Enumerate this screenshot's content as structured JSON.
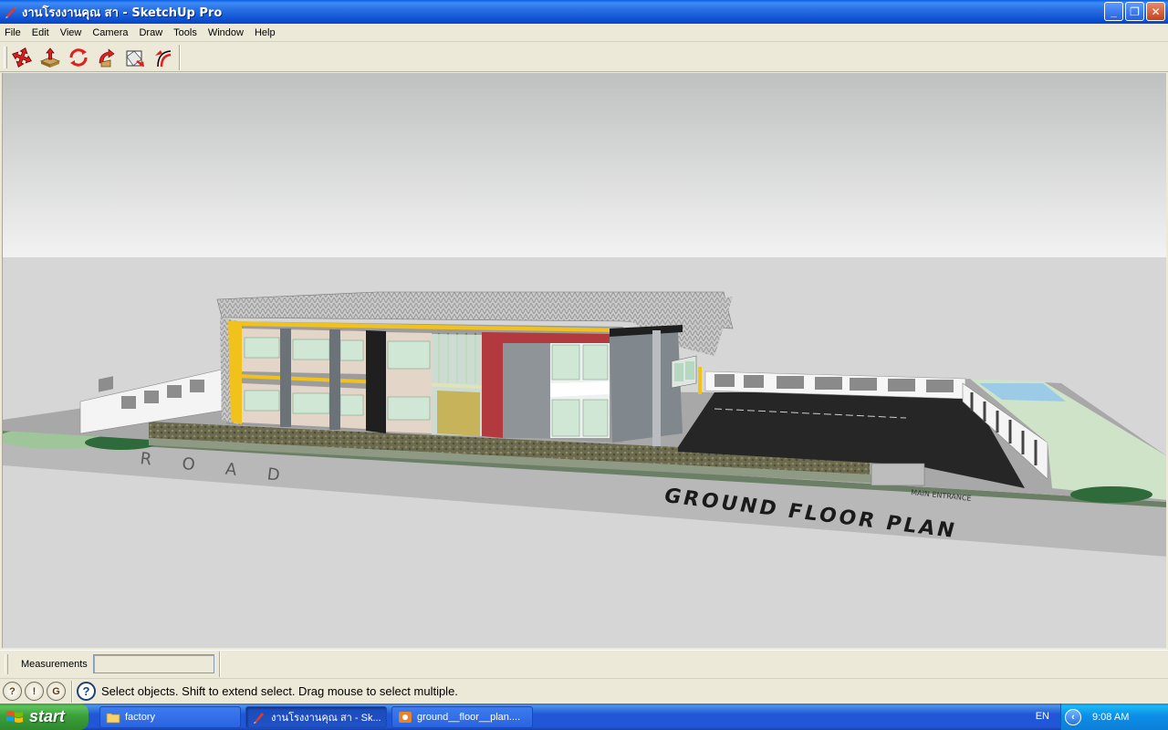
{
  "window": {
    "title": "งานโรงงานคุณ สา - SketchUp Pro",
    "buttons": {
      "minimize": "_",
      "restore": "❐",
      "close": "✕"
    }
  },
  "menu": [
    "File",
    "Edit",
    "View",
    "Camera",
    "Draw",
    "Tools",
    "Window",
    "Help"
  ],
  "toolbar": {
    "tools": [
      {
        "name": "move-tool",
        "icon": "move-icon"
      },
      {
        "name": "push-pull-tool",
        "icon": "push-pull-icon"
      },
      {
        "name": "rotate-tool",
        "icon": "rotate-icon"
      },
      {
        "name": "follow-me-tool",
        "icon": "follow-me-icon"
      },
      {
        "name": "scale-tool",
        "icon": "scale-icon"
      },
      {
        "name": "offset-tool",
        "icon": "offset-icon"
      }
    ]
  },
  "viewport": {
    "texts": {
      "road": "R O A D",
      "plan": "GROUND  FLOOR  PLAN",
      "entrance": "MAIN ENTRANCE"
    },
    "colors": {
      "sky_top": "#bfc1c0",
      "sky_bottom": "#f2f2f2",
      "ground": "#d5d5d5",
      "road": "#b7b7b7",
      "asphalt": "#262626",
      "accent_red": "#b23a3f",
      "accent_yellow": "#f1c21b"
    }
  },
  "measurements": {
    "label": "Measurements",
    "value": ""
  },
  "status": {
    "message": "Select objects. Shift to extend select. Drag mouse to select multiple."
  },
  "taskbar": {
    "start": "start",
    "tasks": [
      {
        "label": "factory",
        "icon": "folder-icon"
      },
      {
        "label": "งานโรงงานคุณ สา - Sk...",
        "icon": "sketchup-icon"
      },
      {
        "label": "ground__floor__plan....",
        "icon": "image-viewer-icon"
      }
    ],
    "language": "EN",
    "time": "9:08 AM"
  }
}
